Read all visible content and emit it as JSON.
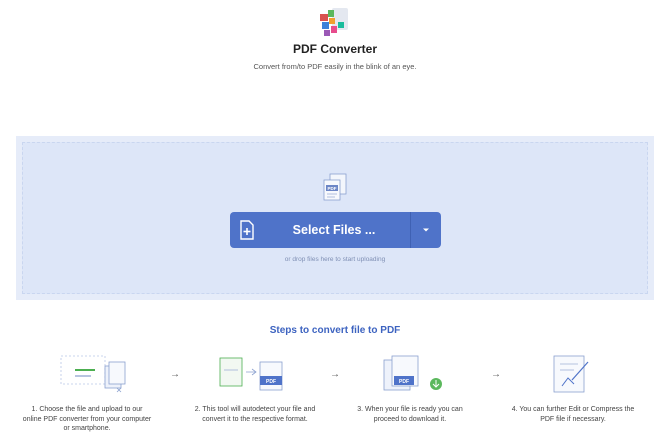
{
  "header": {
    "title": "PDF Converter",
    "subtitle": "Convert from/to PDF easily in the blink of an eye."
  },
  "upload": {
    "select_label": "Select Files ...",
    "drop_hint": "or drop files here to start uploading",
    "file_icon_text": "PDF"
  },
  "steps": {
    "title": "Steps to convert file to PDF",
    "items": [
      {
        "text": "1. Choose the file and upload to our online PDF converter from your computer or smartphone."
      },
      {
        "text": "2. This tool will autodetect your file and convert it to the respective format.",
        "badge": "PDF"
      },
      {
        "text": "3. When your file is ready you can proceed to download it.",
        "badge": "PDF"
      },
      {
        "text": "4. You can further Edit or Compress the PDF file if necessary."
      }
    ],
    "arrow": "→"
  },
  "colors": {
    "accent": "#4f73c9",
    "upload_bg": "#dde6f8",
    "steps_title": "#3d63c0"
  }
}
